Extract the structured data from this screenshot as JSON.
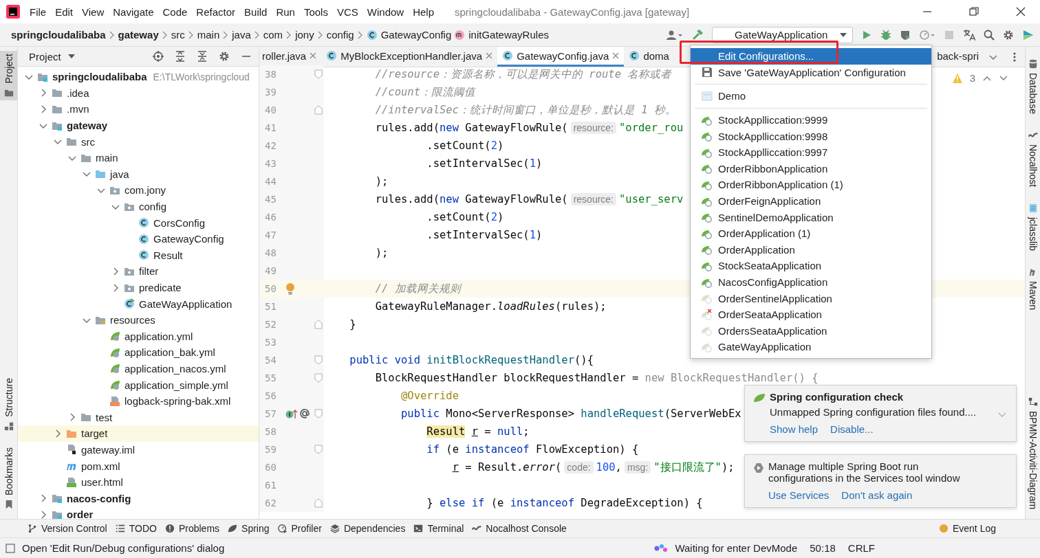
{
  "title_bar": {
    "menus": [
      "File",
      "Edit",
      "View",
      "Navigate",
      "Code",
      "Refactor",
      "Build",
      "Run",
      "Tools",
      "VCS",
      "Window",
      "Help"
    ],
    "title": "springcloudalibaba - GatewayConfig.java [gateway]"
  },
  "nav_bar": {
    "breadcrumbs": [
      {
        "kind": "module",
        "label": "springcloudalibaba"
      },
      {
        "kind": "module",
        "label": "gateway"
      },
      {
        "kind": "folder",
        "label": "src"
      },
      {
        "kind": "folder",
        "label": "main"
      },
      {
        "kind": "folder",
        "label": "java"
      },
      {
        "kind": "folder",
        "label": "com"
      },
      {
        "kind": "folder",
        "label": "jony"
      },
      {
        "kind": "folder",
        "label": "config"
      },
      {
        "kind": "class",
        "label": "GatewayConfig"
      },
      {
        "kind": "method",
        "label": "initGatewayRules"
      }
    ],
    "run_config": "GateWayApplication"
  },
  "left_stripe": [
    {
      "label": "Project",
      "selected": true
    },
    {
      "label": "Structure",
      "selected": false
    },
    {
      "label": "Bookmarks",
      "selected": false
    }
  ],
  "right_stripe": [
    "Database",
    "Nocalhost",
    "jclasslib",
    "Maven",
    "BPMN-Activiti-Diagram"
  ],
  "project": {
    "title": "Project",
    "tree": [
      {
        "kind": "module",
        "label": "springcloudalibaba",
        "path": "E:\\TLWork\\springcloud",
        "expanded": true,
        "selected": false,
        "children": [
          {
            "kind": "folder",
            "label": ".idea",
            "expanded": false,
            "selected": false
          },
          {
            "kind": "folder",
            "label": ".mvn",
            "expanded": false,
            "selected": false
          },
          {
            "kind": "module",
            "label": "gateway",
            "expanded": true,
            "selected": false,
            "children": [
              {
                "kind": "folder",
                "label": "src",
                "expanded": true,
                "selected": false,
                "children": [
                  {
                    "kind": "folder",
                    "label": "main",
                    "expanded": true,
                    "selected": false,
                    "children": [
                      {
                        "kind": "source",
                        "label": "java",
                        "expanded": true,
                        "selected": false,
                        "children": [
                          {
                            "kind": "package",
                            "label": "com.jony",
                            "expanded": true,
                            "selected": false,
                            "children": [
                              {
                                "kind": "package",
                                "label": "config",
                                "expanded": true,
                                "selected": false,
                                "children": [
                                  {
                                    "kind": "class",
                                    "label": "CorsConfig",
                                    "selected": false
                                  },
                                  {
                                    "kind": "class",
                                    "label": "GatewayConfig",
                                    "selected": false
                                  },
                                  {
                                    "kind": "class",
                                    "label": "Result",
                                    "selected": false
                                  }
                                ]
                              },
                              {
                                "kind": "package",
                                "label": "filter",
                                "expanded": false,
                                "selected": false
                              },
                              {
                                "kind": "package",
                                "label": "predicate",
                                "expanded": false,
                                "selected": false
                              },
                              {
                                "kind": "spring-class",
                                "label": "GateWayApplication",
                                "selected": false
                              }
                            ]
                          }
                        ]
                      },
                      {
                        "kind": "resources",
                        "label": "resources",
                        "expanded": true,
                        "selected": false,
                        "children": [
                          {
                            "kind": "yml",
                            "label": "application.yml",
                            "selected": false
                          },
                          {
                            "kind": "yml",
                            "label": "application_bak.yml",
                            "selected": false
                          },
                          {
                            "kind": "yml",
                            "label": "application_nacos.yml",
                            "selected": false
                          },
                          {
                            "kind": "yml",
                            "label": "application_simple.yml",
                            "selected": false
                          },
                          {
                            "kind": "xml",
                            "label": "logback-spring-bak.xml",
                            "selected": false
                          }
                        ]
                      }
                    ]
                  },
                  {
                    "kind": "folder",
                    "label": "test",
                    "expanded": false,
                    "selected": false
                  }
                ]
              },
              {
                "kind": "excluded",
                "label": "target",
                "expanded": false,
                "selected": true
              },
              {
                "kind": "iml",
                "label": "gateway.iml",
                "selected": false
              },
              {
                "kind": "pom",
                "label": "pom.xml",
                "selected": false
              },
              {
                "kind": "html",
                "label": "user.html",
                "selected": false
              }
            ]
          },
          {
            "kind": "module",
            "label": "nacos-config",
            "expanded": false,
            "selected": false
          },
          {
            "kind": "module",
            "label": "order",
            "expanded": false,
            "selected": false
          }
        ]
      }
    ]
  },
  "editor": {
    "tabs": [
      {
        "kind": "partial",
        "label": "roller.java",
        "selected": false,
        "close_button": true
      },
      {
        "kind": "java-class",
        "label": "MyBlockExceptionHandler.java",
        "selected": false,
        "close_button": true
      },
      {
        "kind": "java-class",
        "label": "GatewayConfig.java",
        "selected": true,
        "close_button": true
      },
      {
        "kind": "java-class",
        "label": "doma",
        "selected": false,
        "close_button": false
      },
      {
        "kind": "partial",
        "label": "back-spri",
        "selected": false,
        "close_button": false
      }
    ],
    "warnings": "3",
    "lines": [
      {
        "number": "38",
        "fold_start": true,
        "current": false,
        "tokens": [
          {
            "kind": "comment",
            "text": "        //resource：资源名称，可以是网关中的 route 名称或者"
          }
        ]
      },
      {
        "number": "39",
        "current": false,
        "tokens": [
          {
            "kind": "comment",
            "text": "        //count：限流阈值"
          }
        ]
      },
      {
        "number": "40",
        "fold_end": true,
        "current": false,
        "tokens": [
          {
            "kind": "comment",
            "text": "        //intervalSec：统计时间窗口，单位是秒，默认是 1 秒。"
          }
        ]
      },
      {
        "number": "41",
        "current": false,
        "tokens": [
          {
            "kind": "plain",
            "text": "        rules.add("
          },
          {
            "kind": "kw",
            "text": "new"
          },
          {
            "kind": "plain",
            "text": " GatewayFlowRule("
          },
          {
            "kind": "hint",
            "text": "resource:"
          },
          {
            "kind": "str",
            "text": "\"order_rou"
          }
        ]
      },
      {
        "number": "42",
        "current": false,
        "tokens": [
          {
            "kind": "plain",
            "text": "                .setCount("
          },
          {
            "kind": "num",
            "text": "2"
          },
          {
            "kind": "plain",
            "text": ")"
          }
        ]
      },
      {
        "number": "43",
        "current": false,
        "tokens": [
          {
            "kind": "plain",
            "text": "                .setIntervalSec("
          },
          {
            "kind": "num",
            "text": "1"
          },
          {
            "kind": "plain",
            "text": ")"
          }
        ]
      },
      {
        "number": "44",
        "current": false,
        "tokens": [
          {
            "kind": "plain",
            "text": "        );"
          }
        ]
      },
      {
        "number": "45",
        "current": false,
        "tokens": [
          {
            "kind": "plain",
            "text": "        rules.add("
          },
          {
            "kind": "kw",
            "text": "new"
          },
          {
            "kind": "plain",
            "text": " GatewayFlowRule("
          },
          {
            "kind": "hint",
            "text": "resource:"
          },
          {
            "kind": "str",
            "text": "\"user_serv"
          }
        ]
      },
      {
        "number": "46",
        "current": false,
        "tokens": [
          {
            "kind": "plain",
            "text": "                .setCount("
          },
          {
            "kind": "num",
            "text": "2"
          },
          {
            "kind": "plain",
            "text": ")"
          }
        ]
      },
      {
        "number": "47",
        "current": false,
        "tokens": [
          {
            "kind": "plain",
            "text": "                .setIntervalSec("
          },
          {
            "kind": "num",
            "text": "1"
          },
          {
            "kind": "plain",
            "text": ")"
          }
        ]
      },
      {
        "number": "48",
        "current": false,
        "tokens": [
          {
            "kind": "plain",
            "text": "        );"
          }
        ]
      },
      {
        "number": "49",
        "current": false
      },
      {
        "number": "50",
        "current": true,
        "intention": true,
        "tokens": [
          {
            "kind": "comment",
            "text": "        // 加载网关规则"
          }
        ]
      },
      {
        "number": "51",
        "current": false,
        "tokens": [
          {
            "kind": "plain",
            "text": "        GatewayRuleManager."
          },
          {
            "kind": "italic",
            "text": "loadRules"
          },
          {
            "kind": "plain",
            "text": "(rules);"
          }
        ]
      },
      {
        "number": "52",
        "fold_end": true,
        "current": false,
        "tokens": [
          {
            "kind": "plain",
            "text": "    }"
          }
        ]
      },
      {
        "number": "53",
        "current": false
      },
      {
        "number": "54",
        "fold_start": true,
        "current": false,
        "tokens": [
          {
            "kind": "kw",
            "text": "    public void"
          },
          {
            "kind": "fn",
            "text": " initBlockRequestHandler"
          },
          {
            "kind": "plain",
            "text": "(){"
          }
        ]
      },
      {
        "number": "55",
        "fold_start": true,
        "current": false,
        "tokens": [
          {
            "kind": "plain",
            "text": "        BlockRequestHandler blockRequestHandler = "
          },
          {
            "kind": "grey",
            "text": "new BlockRequestHandler() {"
          }
        ]
      },
      {
        "number": "56",
        "current": false,
        "tokens": [
          {
            "kind": "ann",
            "text": "            @Override"
          }
        ]
      },
      {
        "number": "57",
        "fold_start": true,
        "current": false,
        "overrides": true,
        "tokens": [
          {
            "kind": "kw",
            "text": "            public"
          },
          {
            "kind": "plain",
            "text": " Mono<ServerResponse> "
          },
          {
            "kind": "fn",
            "text": "handleRequest"
          },
          {
            "kind": "plain",
            "text": "(ServerWebEx"
          }
        ]
      },
      {
        "number": "58",
        "current": false,
        "tokens": [
          {
            "kind": "marked",
            "text": "                Result"
          },
          {
            "kind": "under",
            "text": " r"
          },
          {
            "kind": "plain",
            "text": " = "
          },
          {
            "kind": "kw",
            "text": "null"
          },
          {
            "kind": "plain",
            "text": ";"
          }
        ]
      },
      {
        "number": "59",
        "fold_start": true,
        "current": false,
        "tokens": [
          {
            "kind": "kw",
            "text": "                if"
          },
          {
            "kind": "plain",
            "text": " (e "
          },
          {
            "kind": "kw",
            "text": "instanceof"
          },
          {
            "kind": "plain",
            "text": " FlowException) {"
          }
        ]
      },
      {
        "number": "60",
        "current": false,
        "tokens": [
          {
            "kind": "under",
            "text": "                    r"
          },
          {
            "kind": "plain",
            "text": " = Result."
          },
          {
            "kind": "italic",
            "text": "error"
          },
          {
            "kind": "plain",
            "text": "("
          },
          {
            "kind": "hint",
            "text": "code:"
          },
          {
            "kind": "num",
            "text": "100"
          },
          {
            "kind": "plain",
            "text": ","
          },
          {
            "kind": "hint",
            "text": "msg:"
          },
          {
            "kind": "str",
            "text": "\"接口限流了\""
          },
          {
            "kind": "plain",
            "text": ");"
          }
        ]
      },
      {
        "number": "61",
        "current": false
      },
      {
        "number": "62",
        "fold_end": true,
        "current": false,
        "tokens": [
          {
            "kind": "plain",
            "text": "                } "
          },
          {
            "kind": "kw",
            "text": "else if"
          },
          {
            "kind": "plain",
            "text": " (e "
          },
          {
            "kind": "kw",
            "text": "instanceof"
          },
          {
            "kind": "plain",
            "text": " DegradeException) {"
          }
        ]
      }
    ]
  },
  "run_menu": {
    "items": [
      {
        "kind": "edit-action",
        "label": "Edit Configurations...",
        "selected": true
      },
      {
        "kind": "save-action",
        "label": "Save 'GateWayApplication' Configuration",
        "selected": false
      },
      {
        "kind": "separator"
      },
      {
        "kind": "app",
        "label": "Demo",
        "selected": false
      },
      {
        "kind": "separator"
      },
      {
        "kind": "config",
        "label": "StockApplliccation:9999",
        "selected": false,
        "available": true
      },
      {
        "kind": "config",
        "label": "StockApplliccation:9998",
        "selected": false,
        "available": true
      },
      {
        "kind": "config",
        "label": "StockApplliccation:9997",
        "selected": false,
        "available": true
      },
      {
        "kind": "config",
        "label": "OrderRibbonApplication",
        "selected": false,
        "available": true
      },
      {
        "kind": "config",
        "label": "OrderRibbonApplication (1)",
        "selected": false,
        "available": true
      },
      {
        "kind": "config",
        "label": "OrderFeignApplication",
        "selected": false,
        "available": true
      },
      {
        "kind": "config",
        "label": "SentinelDemoApplication",
        "selected": false,
        "available": true
      },
      {
        "kind": "config",
        "label": "OrderApplication (1)",
        "selected": false,
        "available": true
      },
      {
        "kind": "config",
        "label": "OrderApplication",
        "selected": false,
        "available": true
      },
      {
        "kind": "config",
        "label": "StockSeataApplication",
        "selected": false,
        "available": true
      },
      {
        "kind": "config",
        "label": "NacosConfigApplication",
        "selected": false,
        "available": true
      },
      {
        "kind": "config",
        "label": "OrderSentinelApplication",
        "selected": false,
        "available": false
      },
      {
        "kind": "config",
        "label": "OrderSeataApplication",
        "selected": false,
        "available": false,
        "error": true
      },
      {
        "kind": "config",
        "label": "OrdersSeataApplication",
        "selected": false,
        "available": false
      },
      {
        "kind": "config",
        "label": "GateWayApplication",
        "selected": false,
        "available": false
      }
    ]
  },
  "notifications": [
    {
      "kind": "spring",
      "title": "Spring configuration check",
      "body": "Unmapped Spring configuration files found....",
      "links": [
        "Show help",
        "Disable..."
      ]
    },
    {
      "kind": "services",
      "body": "Manage multiple Spring Boot run configurations in the Services tool window",
      "links": [
        "Use Services",
        "Don't ask again"
      ]
    }
  ],
  "tool_windows": [
    "Version Control",
    "TODO",
    "Problems",
    "Spring",
    "Profiler",
    "Dependencies",
    "Terminal",
    "Nocalhost Console"
  ],
  "tool_windows_right": [
    "Event Log"
  ],
  "status_bar": {
    "message": "Open 'Edit Run/Debug configurations' dialog",
    "devmode": "Waiting for enter DevMode",
    "position": "50:18",
    "line_ending": "CRLF"
  }
}
